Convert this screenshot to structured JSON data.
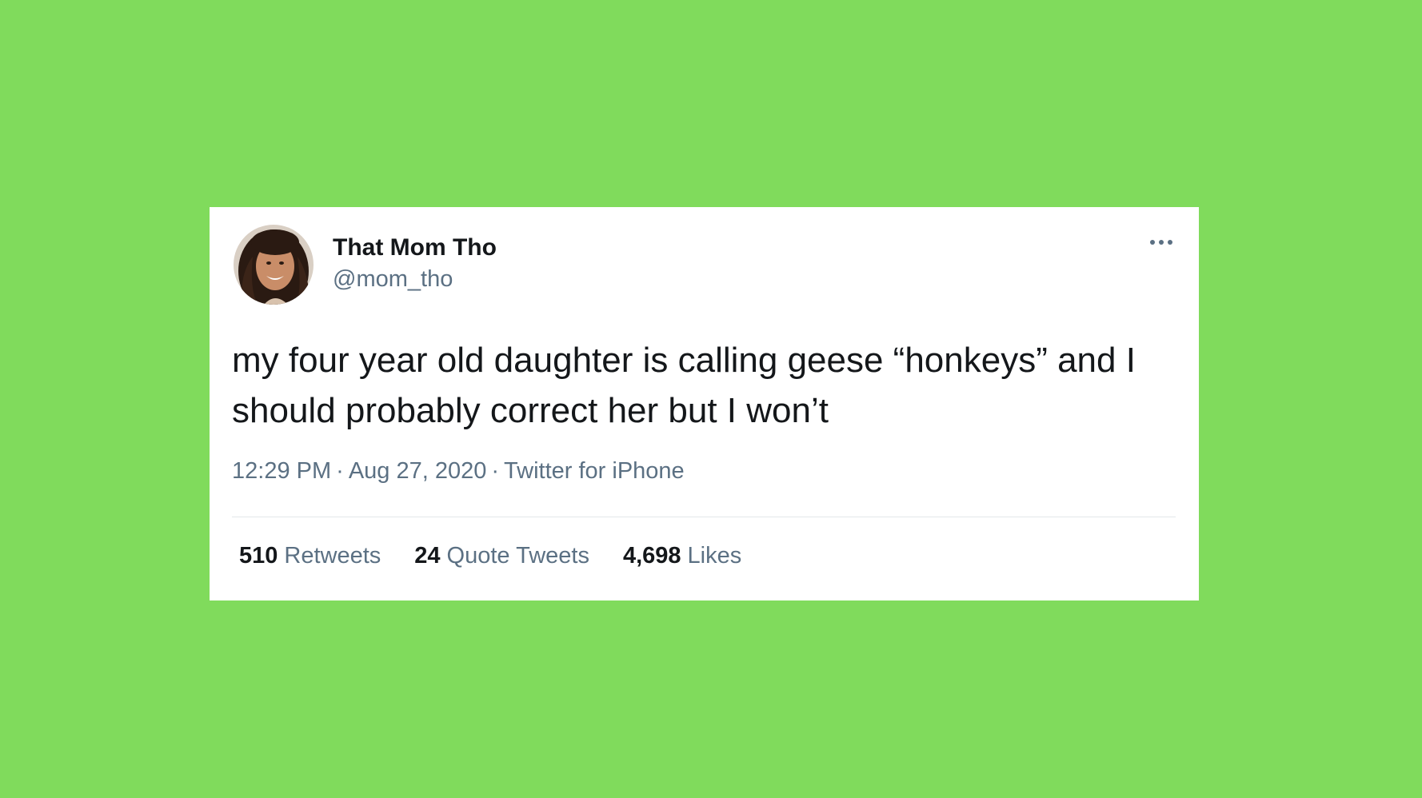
{
  "background_color": "#80db5c",
  "tweet": {
    "author": {
      "display_name": "That Mom Tho",
      "handle": "@mom_tho",
      "avatar_icon": "profile-photo"
    },
    "more_icon": "more-options-icon",
    "text": "my four year old daughter is calling geese “honkeys” and I should probably correct her but I won’t",
    "time": "12:29 PM",
    "date": "Aug 27, 2020",
    "source": "Twitter for iPhone",
    "stats": {
      "retweets_count": "510",
      "retweets_label": "Retweets",
      "quotes_count": "24",
      "quotes_label": "Quote Tweets",
      "likes_count": "4,698",
      "likes_label": "Likes"
    },
    "colors": {
      "card": "#ffffff",
      "text_primary": "#14171a",
      "text_secondary": "#5b7083",
      "divider": "#e3e7ea"
    }
  }
}
